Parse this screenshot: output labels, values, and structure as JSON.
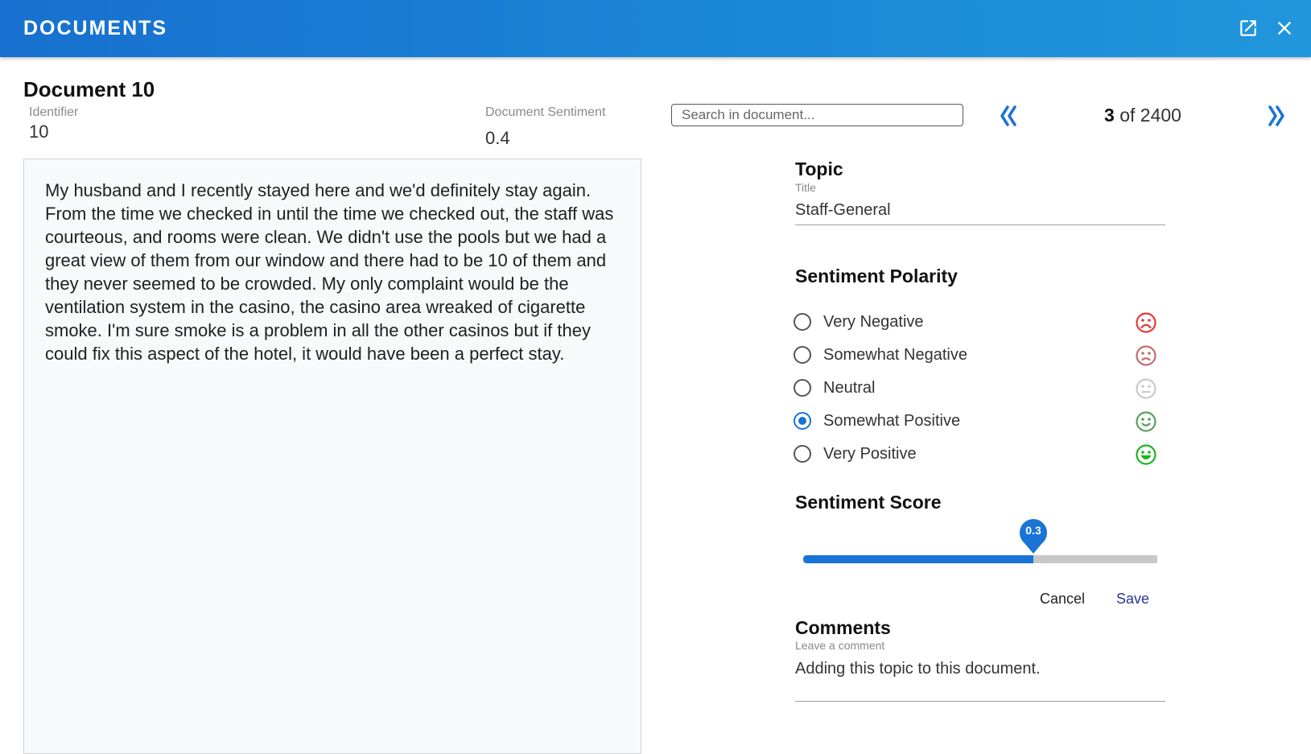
{
  "header": {
    "title": "DOCUMENTS",
    "open_external_icon": "open-in-new-icon",
    "close_icon": "close-icon",
    "text_color": "#ffffff",
    "bg_color": "#1a7fd4"
  },
  "document": {
    "title": "Document 10",
    "identifier_label": "Identifier",
    "identifier_value": "10",
    "sentiment_label": "Document Sentiment",
    "sentiment_value": "0.4",
    "body": "My husband and I recently stayed here and we'd definitely stay again. From the time we checked in until the time we checked out, the staff was courteous, and rooms were clean. We didn't use the pools but we had a great view of them from our window and there had to be 10 of them and they never seemed to be crowded. My only complaint would be the ventilation system in the casino, the casino area wreaked of cigarette smoke. I'm sure smoke is a problem in all the other casinos but if they could fix this aspect of the hotel, it would have been a perfect stay."
  },
  "search": {
    "placeholder": "Search in document...",
    "value": ""
  },
  "pager": {
    "current": "3",
    "separator": "of",
    "total": "2400",
    "prev_icon": "double-chevron-left-icon",
    "next_icon": "double-chevron-right-icon"
  },
  "topic": {
    "heading": "Topic",
    "title_label": "Title",
    "title_value": "Staff-General"
  },
  "polarity": {
    "heading": "Sentiment Polarity",
    "options": [
      {
        "label": "Very Negative",
        "icon": "very-dissatisfied-face-icon",
        "color": "#e53935",
        "checked": false
      },
      {
        "label": "Somewhat Negative",
        "icon": "dissatisfied-face-icon",
        "color": "#c66a6a",
        "checked": false
      },
      {
        "label": "Neutral",
        "icon": "neutral-face-icon",
        "color": "#c9c9c9",
        "checked": false
      },
      {
        "label": "Somewhat Positive",
        "icon": "satisfied-face-icon",
        "color": "#5aa05a",
        "checked": true
      },
      {
        "label": "Very Positive",
        "icon": "very-satisfied-face-icon",
        "color": "#1db31d",
        "checked": false
      }
    ]
  },
  "score": {
    "heading": "Sentiment Score",
    "value": 0.3,
    "value_label": "0.3",
    "min": -1,
    "max": 1,
    "fill_color": "#1a73d6"
  },
  "actions": {
    "cancel_label": "Cancel",
    "save_label": "Save",
    "save_color": "#283593"
  },
  "comments": {
    "heading": "Comments",
    "field_label": "Leave a comment",
    "value": "Adding this topic to this document."
  }
}
